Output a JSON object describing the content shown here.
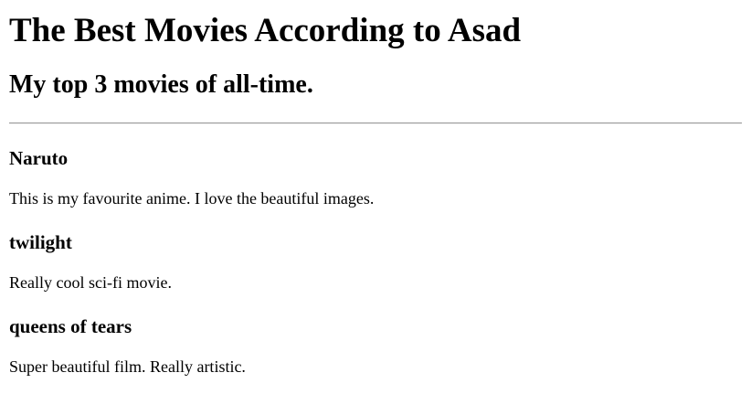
{
  "page": {
    "title": "The Best Movies According to Asad",
    "subtitle": "My top 3 movies of all-time."
  },
  "movies": [
    {
      "name": "Naruto",
      "description": "This is my favourite anime. I love the beautiful images."
    },
    {
      "name": "twilight",
      "description": "Really cool sci-fi movie."
    },
    {
      "name": "queens of tears",
      "description": "Super beautiful film. Really artistic."
    }
  ]
}
